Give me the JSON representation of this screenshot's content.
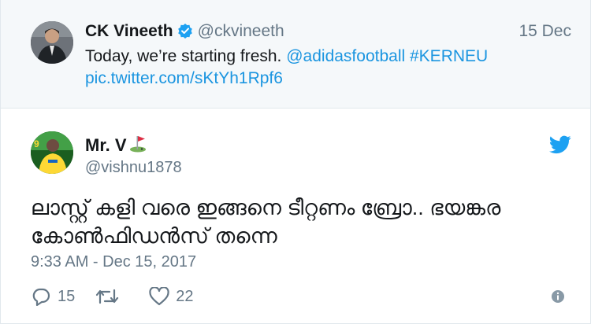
{
  "parent_tweet": {
    "author_name": "CK Vineeth",
    "author_handle": "@ckvineeth",
    "date": "15 Dec",
    "text": "Today, we’re starting fresh.",
    "mention": "@adidasfootball",
    "hashtag": "#KERNEU",
    "pic_link": "pic.twitter.com/sKtYh1Rpf6",
    "verified_icon": "verified-badge-icon"
  },
  "tweet": {
    "author_name": "Mr. V",
    "author_handle": "@vishnu1878",
    "name_emoji": "golf-flag-emoji",
    "text": "ലാസ്റ്റ് കളി വരെ ഇങ്ങനെ ടീറ്റണം ബ്രോ.. ഭയങ്കര കോൺഫിഡൻസ് തന്നെ",
    "timestamp": "9:33 AM - Dec 15, 2017",
    "replies": "15",
    "likes": "22"
  },
  "colors": {
    "link": "#1b95e0",
    "secondary_text": "#657786",
    "parent_background": "#f5f8fa",
    "border": "#e1e8ed"
  },
  "icons": [
    "verified-badge-icon",
    "twitter-bird-icon",
    "reply-icon",
    "retweet-icon",
    "like-heart-icon",
    "info-icon"
  ]
}
